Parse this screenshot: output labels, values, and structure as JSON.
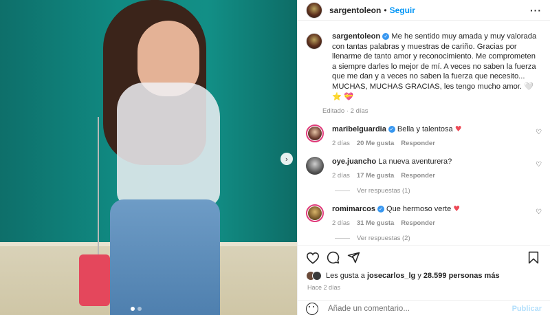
{
  "post": {
    "author": "sargentoleon",
    "follow_label": "Seguir",
    "separator": "•",
    "more_label": "···",
    "caption": "Me he sentido muy amada y muy valorada con tantas palabras y muestras de cariño. Gracias por llenarme de tanto amor y reconocimiento. Me comprometen a siempre darles lo mejor de mí. A veces no saben la fuerza que me dan y a veces no saben la fuerza que necesito... MUCHAS, MUCHAS GRACIAS, les tengo mucho amor. 🤍 ⭐ 💝",
    "caption_meta": "Editado · 2 días"
  },
  "comments": [
    {
      "user": "maribelguardia",
      "verified": true,
      "text": "Bella y talentosa",
      "emoji": "♥",
      "age": "2 días",
      "likes": "20 Me gusta",
      "reply_label": "Responder",
      "replies": ""
    },
    {
      "user": "oye.juancho",
      "verified": false,
      "text": "La nueva aventurera?",
      "emoji": "",
      "age": "2 días",
      "likes": "17 Me gusta",
      "reply_label": "Responder",
      "replies": "Ver respuestas (1)"
    },
    {
      "user": "romimarcos",
      "verified": true,
      "text": "Que hermoso verte",
      "emoji": "♥",
      "age": "2 días",
      "likes": "31 Me gusta",
      "reply_label": "Responder",
      "replies": "Ver respuestas (2)"
    }
  ],
  "likes_bar": {
    "prefix": "Les gusta a",
    "user": "josecarlos_lg",
    "joiner": "y",
    "others": "28.599 personas más"
  },
  "timestamp": "Hace 2 días",
  "add_comment": {
    "placeholder": "Añade un comentario...",
    "publish_label": "Publicar"
  },
  "icons": {
    "like": "heart-icon",
    "comment": "comment-icon",
    "share": "share-icon",
    "save": "bookmark-icon",
    "emoji": "emoji-icon",
    "next": "chevron-right-icon"
  },
  "colors": {
    "accent": "#0095f6",
    "verified": "#3897f0",
    "heart": "#ed4956",
    "muted": "#8e8e8e"
  }
}
